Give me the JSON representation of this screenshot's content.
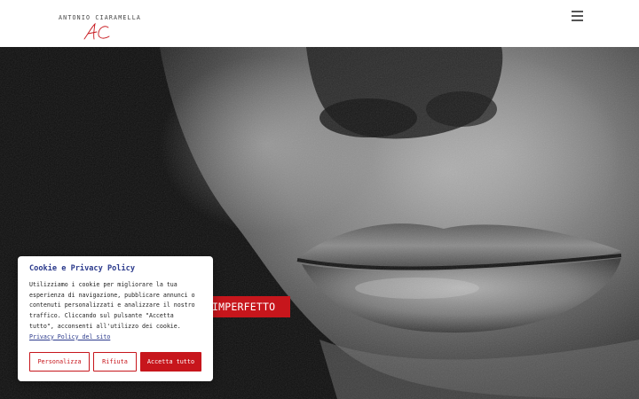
{
  "header": {
    "logo_name": "ANTONIO CIARAMELLA",
    "logo_mark": "AC"
  },
  "hero": {
    "tagline": "IMPERFETTO"
  },
  "cookie_banner": {
    "title": "Cookie e Privacy Policy",
    "text": "Utilizziamo i cookie per migliorare la tua esperienza di navigazione, pubblicare annunci o contenuti personalizzati e analizzare il nostro traffico. Cliccando sul pulsante \"Accetta tutto\", acconsenti all'utilizzo dei cookie.",
    "link_label": "Privacy Policy del sito",
    "buttons": {
      "customize": "Personalizza",
      "reject": "Rifiuta",
      "accept": "Accetta tutto"
    }
  },
  "colors": {
    "accent": "#c7161c",
    "link": "#2b3a8c"
  }
}
